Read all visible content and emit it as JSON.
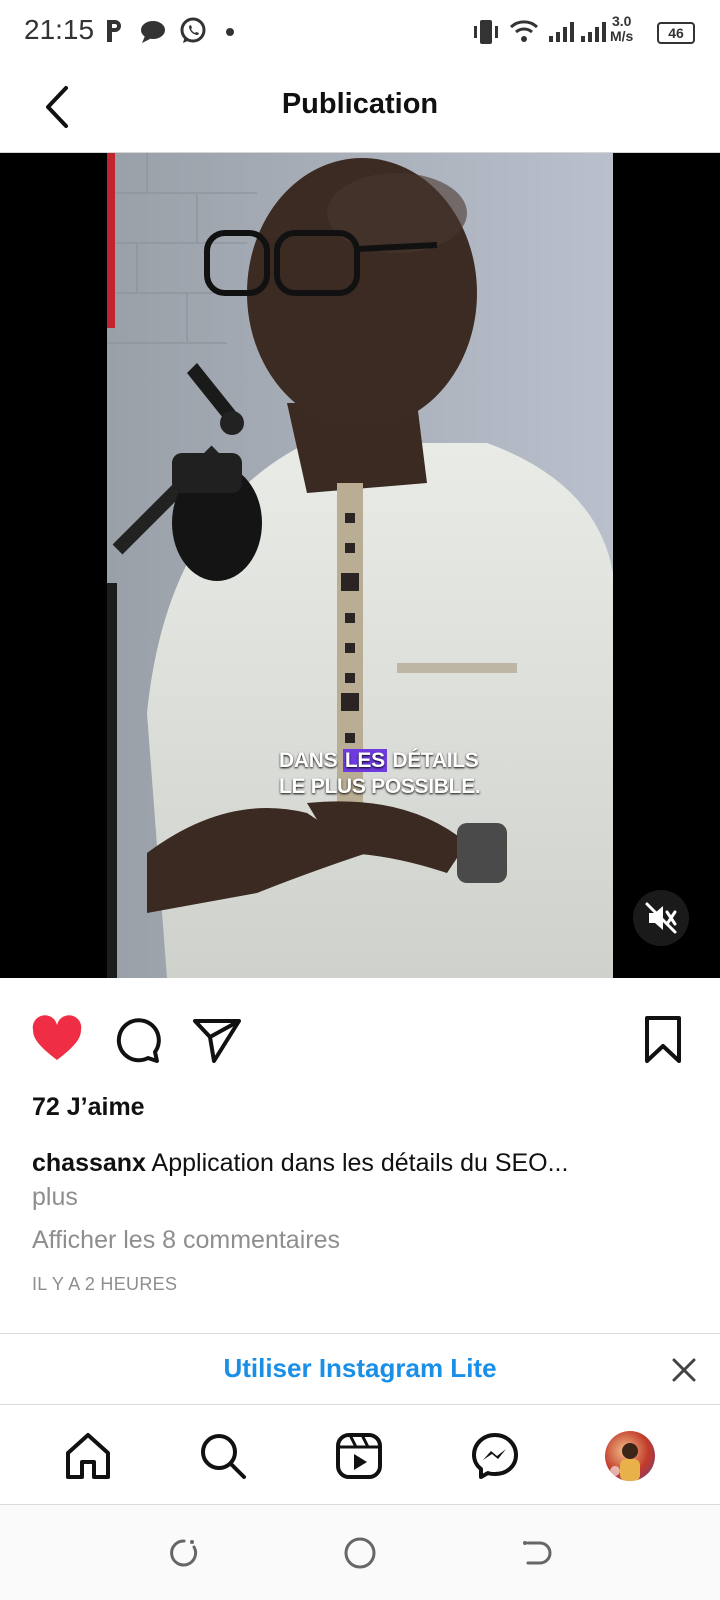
{
  "status_bar": {
    "time": "21:15",
    "network_speed": "3.0",
    "network_unit": "M/s",
    "battery": "46"
  },
  "header": {
    "title": "Publication"
  },
  "post": {
    "video_caption_line1_a": "DANS ",
    "video_caption_line1_highlight": "LES",
    "video_caption_line1_b": " DÉTAILS",
    "video_caption_line2": "LE PLUS POSSIBLE.",
    "likes_text": "72 J’aime",
    "username": "chassanx",
    "caption": "Application dans les détails du SEO...",
    "more_label": "plus",
    "view_comments": "Afficher les 8 commentaires",
    "time_ago": "IL Y A 2 HEURES"
  },
  "banner": {
    "text": "Utiliser Instagram Lite"
  },
  "icons": {
    "like": "heart-icon",
    "comment": "comment-icon",
    "share": "send-icon",
    "save": "bookmark-icon",
    "nav": [
      "home-icon",
      "search-icon",
      "reels-icon",
      "messenger-icon",
      "profile-avatar"
    ]
  },
  "colors": {
    "like_red": "#ef2e45",
    "link_blue": "#1a8fe8",
    "muted_gray": "#8e8e8e"
  }
}
